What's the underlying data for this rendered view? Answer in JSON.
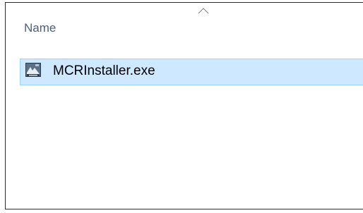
{
  "file_list": {
    "column_header": "Name",
    "sort_indicator": "sort-ascending-chevron",
    "items": [
      {
        "name": "MCRInstaller.exe",
        "icon": "installer-exe-icon",
        "selected": true
      }
    ]
  },
  "colors": {
    "selection_fill": "#cde8ff",
    "selection_border": "#99d1ff",
    "header_text": "#4c607a"
  }
}
